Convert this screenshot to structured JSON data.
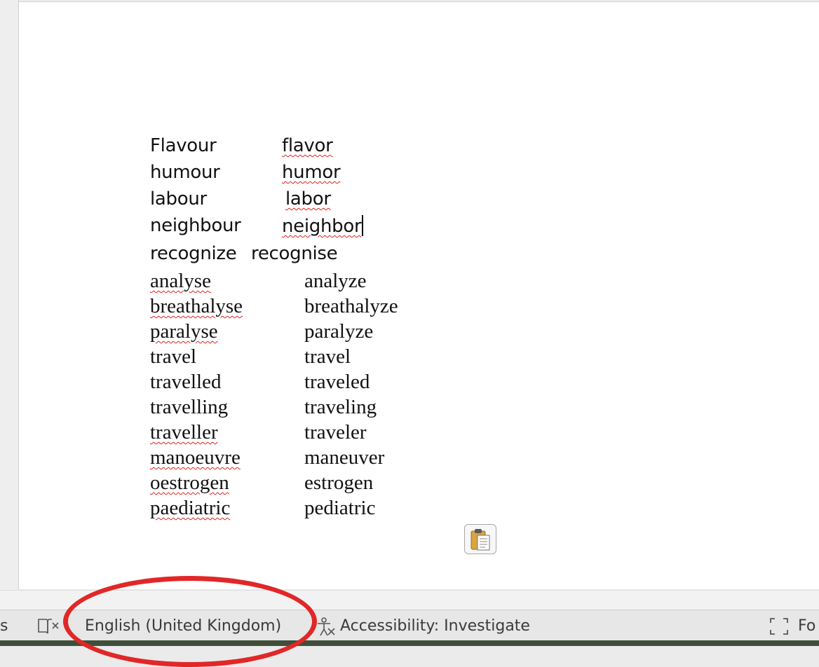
{
  "document": {
    "sans_rows": [
      {
        "left": "Flavour",
        "right": "flavor",
        "left_err": false,
        "right_err": true,
        "caret": false
      },
      {
        "left": "humour",
        "right": "humor",
        "left_err": false,
        "right_err": true,
        "caret": false
      },
      {
        "left": "labour",
        "right": "labor",
        "left_err": false,
        "right_err": true,
        "caret": false
      },
      {
        "left": "neighbour",
        "right": "neighbor",
        "left_err": false,
        "right_err": true,
        "caret": true
      }
    ],
    "mixed_row": {
      "left": "recognize",
      "right": "recognise"
    },
    "serif_rows": [
      {
        "left": "analyse",
        "right": "analyze",
        "left_err": true,
        "right_err": false
      },
      {
        "left": "breathalyse",
        "right": "breathalyze",
        "left_err": true,
        "right_err": false
      },
      {
        "left": "paralyse",
        "right": "paralyze",
        "left_err": true,
        "right_err": false
      },
      {
        "left": "travel",
        "right": "travel",
        "left_err": false,
        "right_err": false
      },
      {
        "left": "travelled",
        "right": "traveled",
        "left_err": false,
        "right_err": false
      },
      {
        "left": "travelling",
        "right": "traveling",
        "left_err": false,
        "right_err": false
      },
      {
        "left": "traveller",
        "right": "traveler",
        "left_err": true,
        "right_err": false
      },
      {
        "left": "manoeuvre",
        "right": "maneuver",
        "left_err": true,
        "right_err": false
      },
      {
        "left": "oestrogen",
        "right": "estrogen",
        "left_err": true,
        "right_err": false
      },
      {
        "left": "paediatric",
        "right": "pediatric",
        "left_err": true,
        "right_err": false
      }
    ],
    "paste_options_icon": "clipboard-icon"
  },
  "statusbar": {
    "left_fragment": "s",
    "proofing_icon": "book-x-icon",
    "language": "English (United Kingdom)",
    "accessibility_icon": "accessibility-icon",
    "accessibility": "Accessibility: Investigate",
    "focus_icon": "focus-mode-icon",
    "focus_fragment": "Fo"
  },
  "annotation": {
    "color": "#e12727",
    "shape": "ellipse"
  },
  "colors": {
    "spell_error": "#e0211d",
    "page": "#ffffff",
    "statusbar": "#e7e7e7"
  }
}
